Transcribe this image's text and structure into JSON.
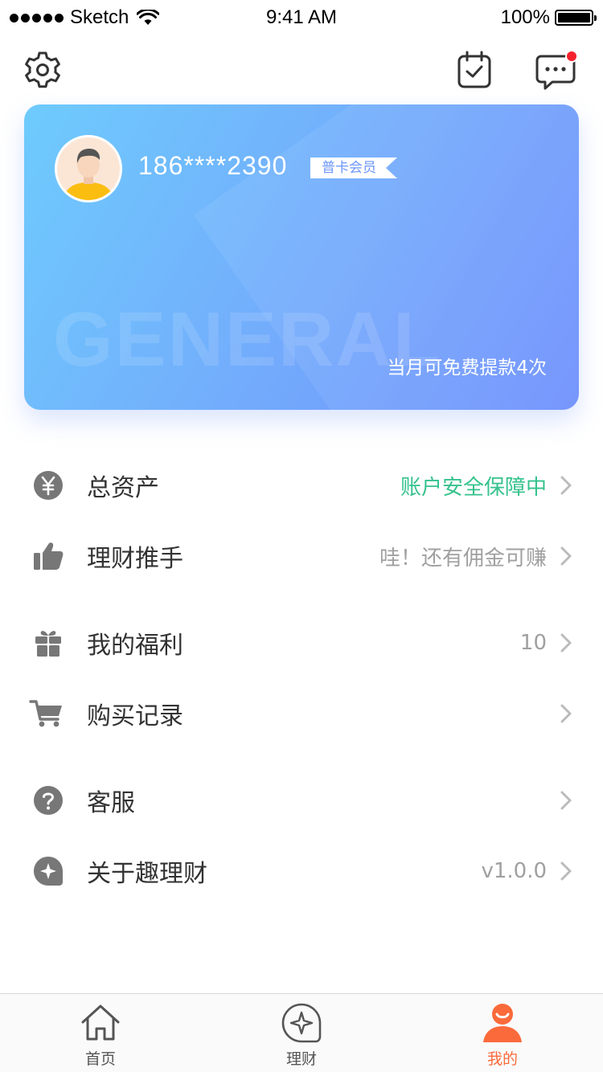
{
  "status_bar": {
    "carrier": "Sketch",
    "time": "9:41 AM",
    "battery": "100%"
  },
  "profile": {
    "phone": "186****2390",
    "member_badge": "普卡会员",
    "card_watermark": "GENERAL",
    "withdraw_quota": "当月可免费提款4次"
  },
  "menu": [
    {
      "label": "总资产",
      "value": "账户安全保障中",
      "icon": "yuan-icon"
    },
    {
      "label": "理财推手",
      "value": "哇！还有佣金可赚",
      "icon": "thumbs-up-icon"
    },
    {
      "label": "我的福利",
      "value": "10",
      "icon": "gift-icon"
    },
    {
      "label": "购买记录",
      "value": "",
      "icon": "cart-icon"
    },
    {
      "label": "客服",
      "value": "",
      "icon": "question-icon"
    },
    {
      "label": "关于趣理财",
      "value": "v1.0.0",
      "icon": "sparkle-icon"
    }
  ],
  "tabs": [
    {
      "label": "首页",
      "icon": "home-icon",
      "active": false
    },
    {
      "label": "理财",
      "icon": "finance-icon",
      "active": false
    },
    {
      "label": "我的",
      "icon": "profile-icon",
      "active": true
    }
  ],
  "colors": {
    "accent": "#fb6a3a",
    "safe_green": "#35c28c",
    "card_blue": "#73aafc",
    "notification_red": "#f5222d"
  }
}
